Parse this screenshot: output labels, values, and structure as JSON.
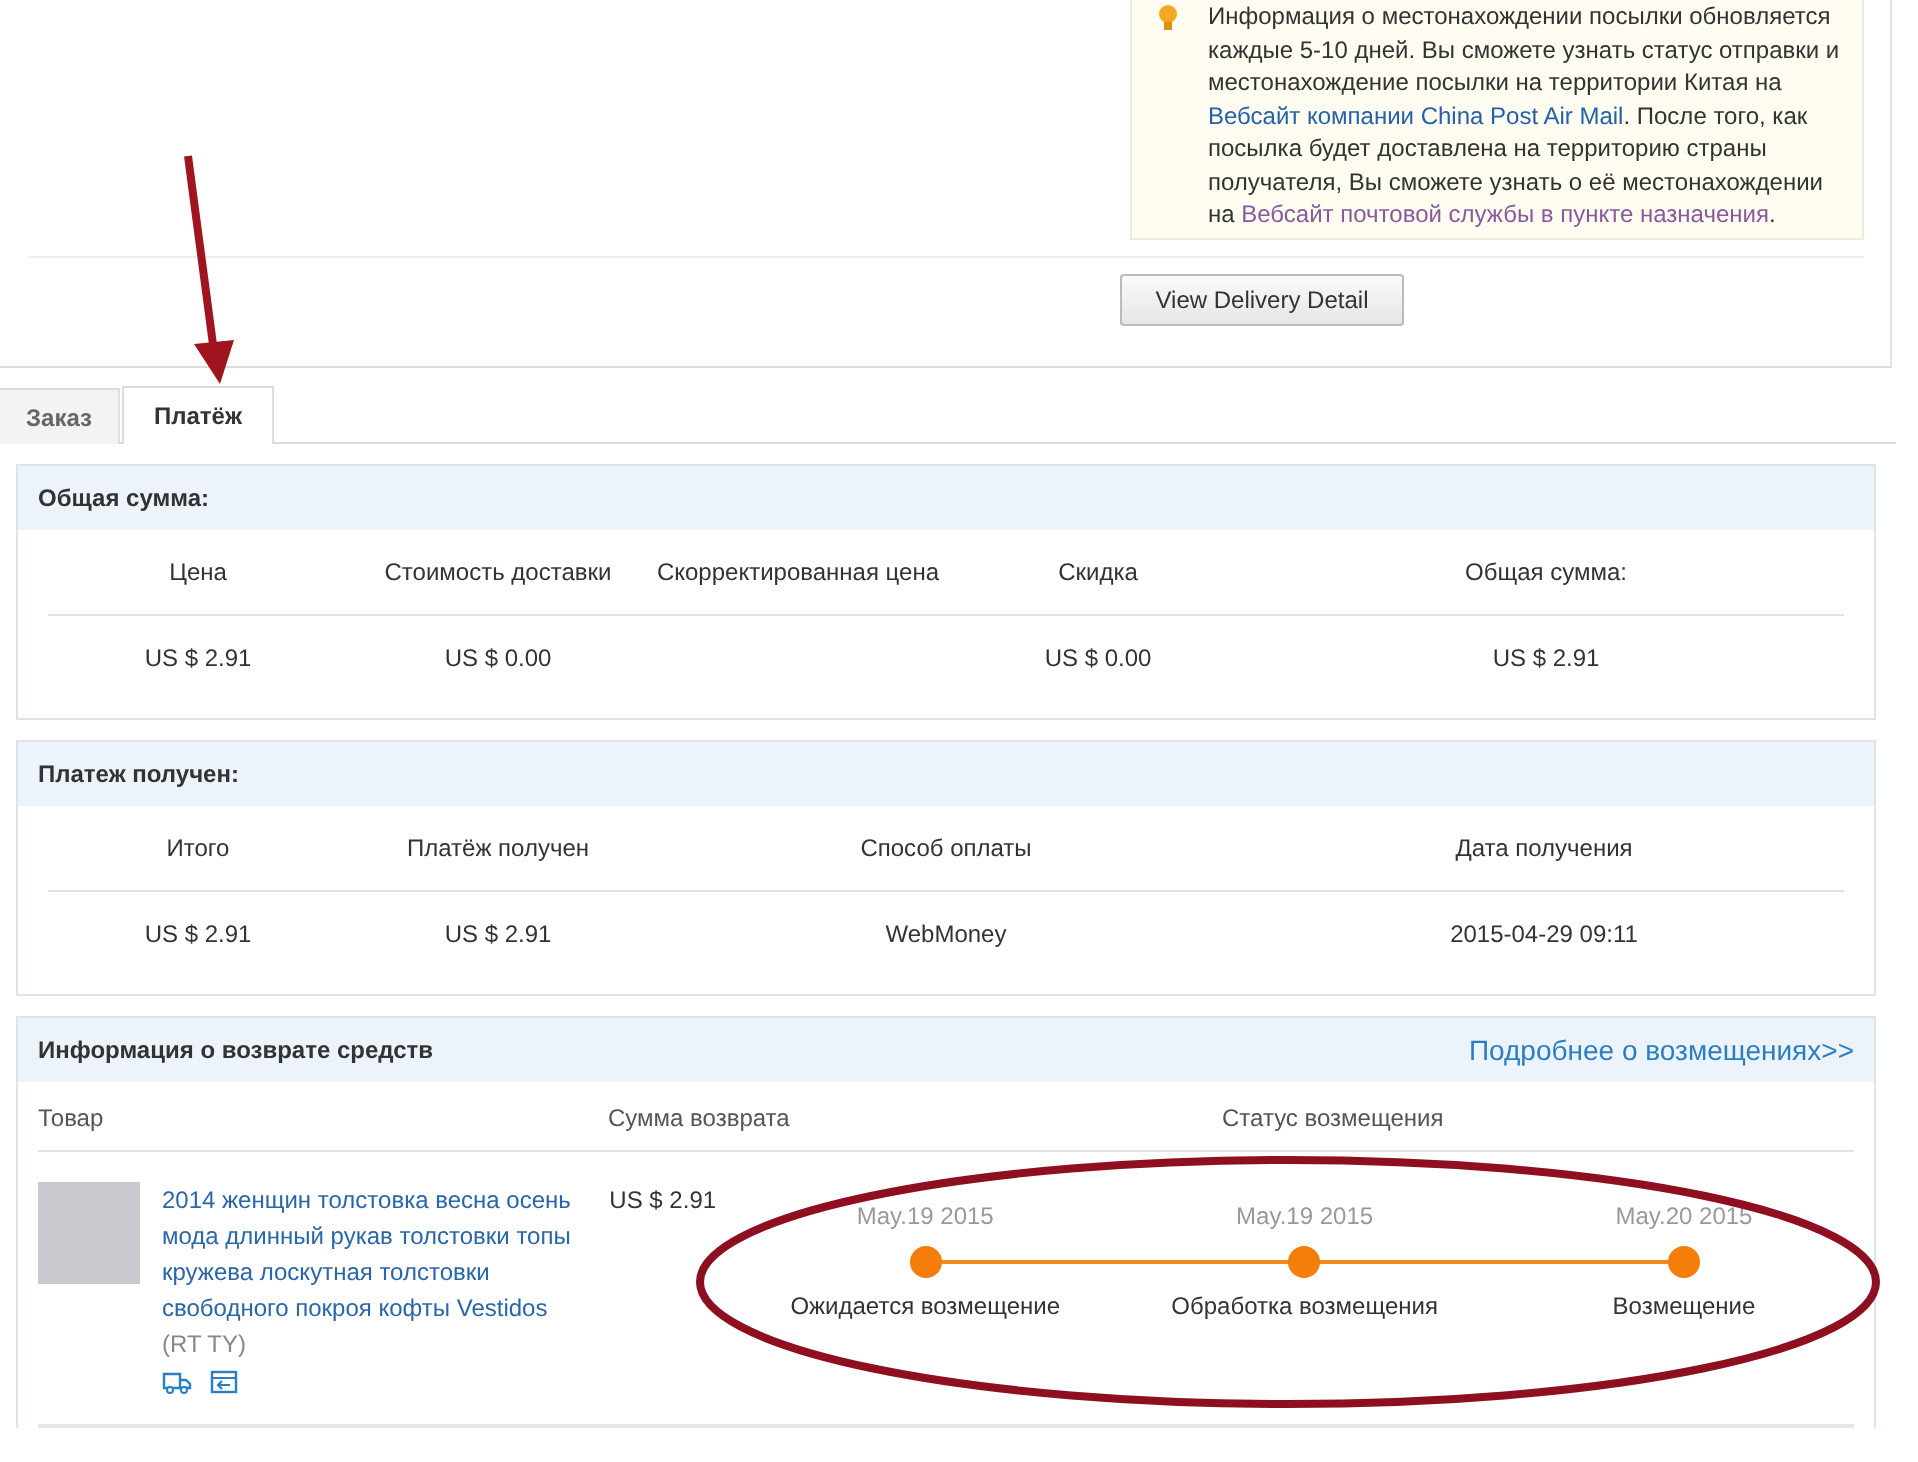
{
  "notice": {
    "segments": [
      {
        "kind": "text",
        "text": "Информация о местонахождении посылки обновляется каждые 5-10 дней. Вы сможете узнать статус отправки и местонахождение посылки на территории Китая на "
      },
      {
        "kind": "link",
        "text": "Вебсайт компании China Post Air Mail",
        "visited": false
      },
      {
        "kind": "text",
        "text": ". После того, как посылка будет доставлена на территорию страны получателя, Вы сможете узнать о её местонахождении на "
      },
      {
        "kind": "link",
        "text": "Вебсайт почтовой службы в пункте назначения",
        "visited": true
      },
      {
        "kind": "text",
        "text": "."
      }
    ]
  },
  "delivery_button": "View Delivery Detail",
  "tabs": [
    {
      "label": "Заказ",
      "selected": false
    },
    {
      "label": "Платёж",
      "selected": true
    }
  ],
  "total": {
    "title": "Общая сумма:",
    "columns": [
      {
        "header": "Цена",
        "value": "US $ 2.91"
      },
      {
        "header": "Стоимость доставки",
        "value": "US $ 0.00"
      },
      {
        "header": "Скорректированная цена"
      },
      {
        "header": "Скидка",
        "value": "US $ 0.00"
      },
      {
        "header": "Общая сумма:",
        "value": "US $ 2.91"
      }
    ]
  },
  "payment": {
    "title": "Платеж получен:",
    "columns": [
      "Итого",
      "Платёж получен",
      "Способ оплаты",
      "Дата получения"
    ],
    "values": [
      "US $ 2.91",
      "US $ 2.91",
      "WebMoney",
      "2015-04-29 09:11"
    ]
  },
  "refund": {
    "title": "Информация о возврате средств",
    "link": "Подробнее о возмещениях>>",
    "columns": [
      "Товар",
      "Сумма возврата",
      "Статус возмещения"
    ],
    "item": {
      "title": "2014 женщин толстовка весна осень мода длинный рукав толстовки топы кружева лоскутная толстовки свободного покроя кофты Vestidos",
      "variant": "(RT TY)",
      "amount": "US $ 2.91",
      "steps": [
        {
          "date": "May.19 2015",
          "label": "Ожидается возмещение",
          "done": true
        },
        {
          "date": "May.19 2015",
          "label": "Обработка возмещения",
          "done": true
        },
        {
          "date": "May.20 2015",
          "label": "Возмещение",
          "done": true
        }
      ]
    }
  }
}
